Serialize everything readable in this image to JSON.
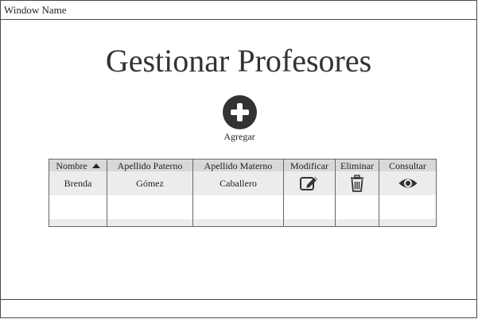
{
  "window": {
    "title": "Window Name"
  },
  "page": {
    "title": "Gestionar Profesores"
  },
  "add_button": {
    "label": "Agregar",
    "icon": "plus-circle-icon"
  },
  "table": {
    "columns": [
      "Nombre",
      "Apellido Paterno",
      "Apellido Materno",
      "Modificar",
      "Eliminar",
      "Consultar"
    ],
    "sort_column": "Nombre",
    "sort_direction": "ascending",
    "rows": [
      {
        "nombre": "Brenda",
        "apellido_paterno": "Gómez",
        "apellido_materno": "Caballero"
      }
    ],
    "action_icons": {
      "modify": "edit-icon",
      "delete": "trash-icon",
      "view": "eye-icon"
    }
  },
  "colors": {
    "header_bg": "#d8d8d8",
    "row_alt_bg": "#ececec",
    "icon": "#333333"
  }
}
